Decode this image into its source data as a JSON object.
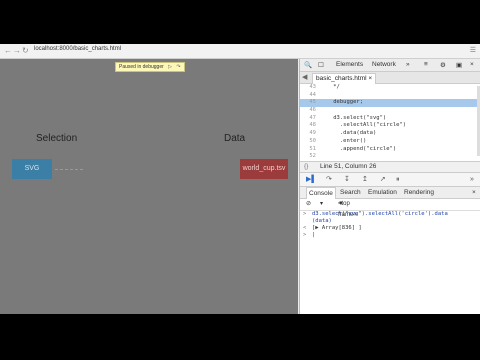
{
  "browser": {
    "url": "localhost:8000/basic_charts.html"
  },
  "page": {
    "paused_banner": "Paused in debugger",
    "selection_heading": "Selection",
    "data_heading": "Data",
    "svg_box_label": "SVG",
    "data_box_label": "world_cup.tsv"
  },
  "devtools": {
    "top_tabs": [
      "Elements",
      "Network"
    ],
    "file_tab": "basic_charts.html",
    "code_lines": [
      {
        "num": "43",
        "text": "    */"
      },
      {
        "num": "44",
        "text": ""
      },
      {
        "num": "45",
        "text": "    debugger;"
      },
      {
        "num": "46",
        "text": ""
      },
      {
        "num": "47",
        "text": "    d3.select(\"svg\")"
      },
      {
        "num": "48",
        "text": "      .selectAll(\"circle\")"
      },
      {
        "num": "49",
        "text": "      .data(data)"
      },
      {
        "num": "50",
        "text": "      .enter()"
      },
      {
        "num": "51",
        "text": "      .append(\"circle\")"
      },
      {
        "num": "52",
        "text": ""
      }
    ],
    "cursor_position": "Line 51, Column 26",
    "console_tabs": [
      "Console",
      "Search",
      "Emulation",
      "Rendering"
    ],
    "frame_selector": "<top frame>",
    "console_lines": [
      {
        "prompt": ">",
        "text": "d3.select(\"svg\").selectAll('circle').data"
      },
      {
        "prompt": "",
        "text": "(data)"
      },
      {
        "prompt": "<",
        "text": "[▶ Array[836] ]"
      },
      {
        "prompt": ">",
        "text": ""
      }
    ]
  }
}
